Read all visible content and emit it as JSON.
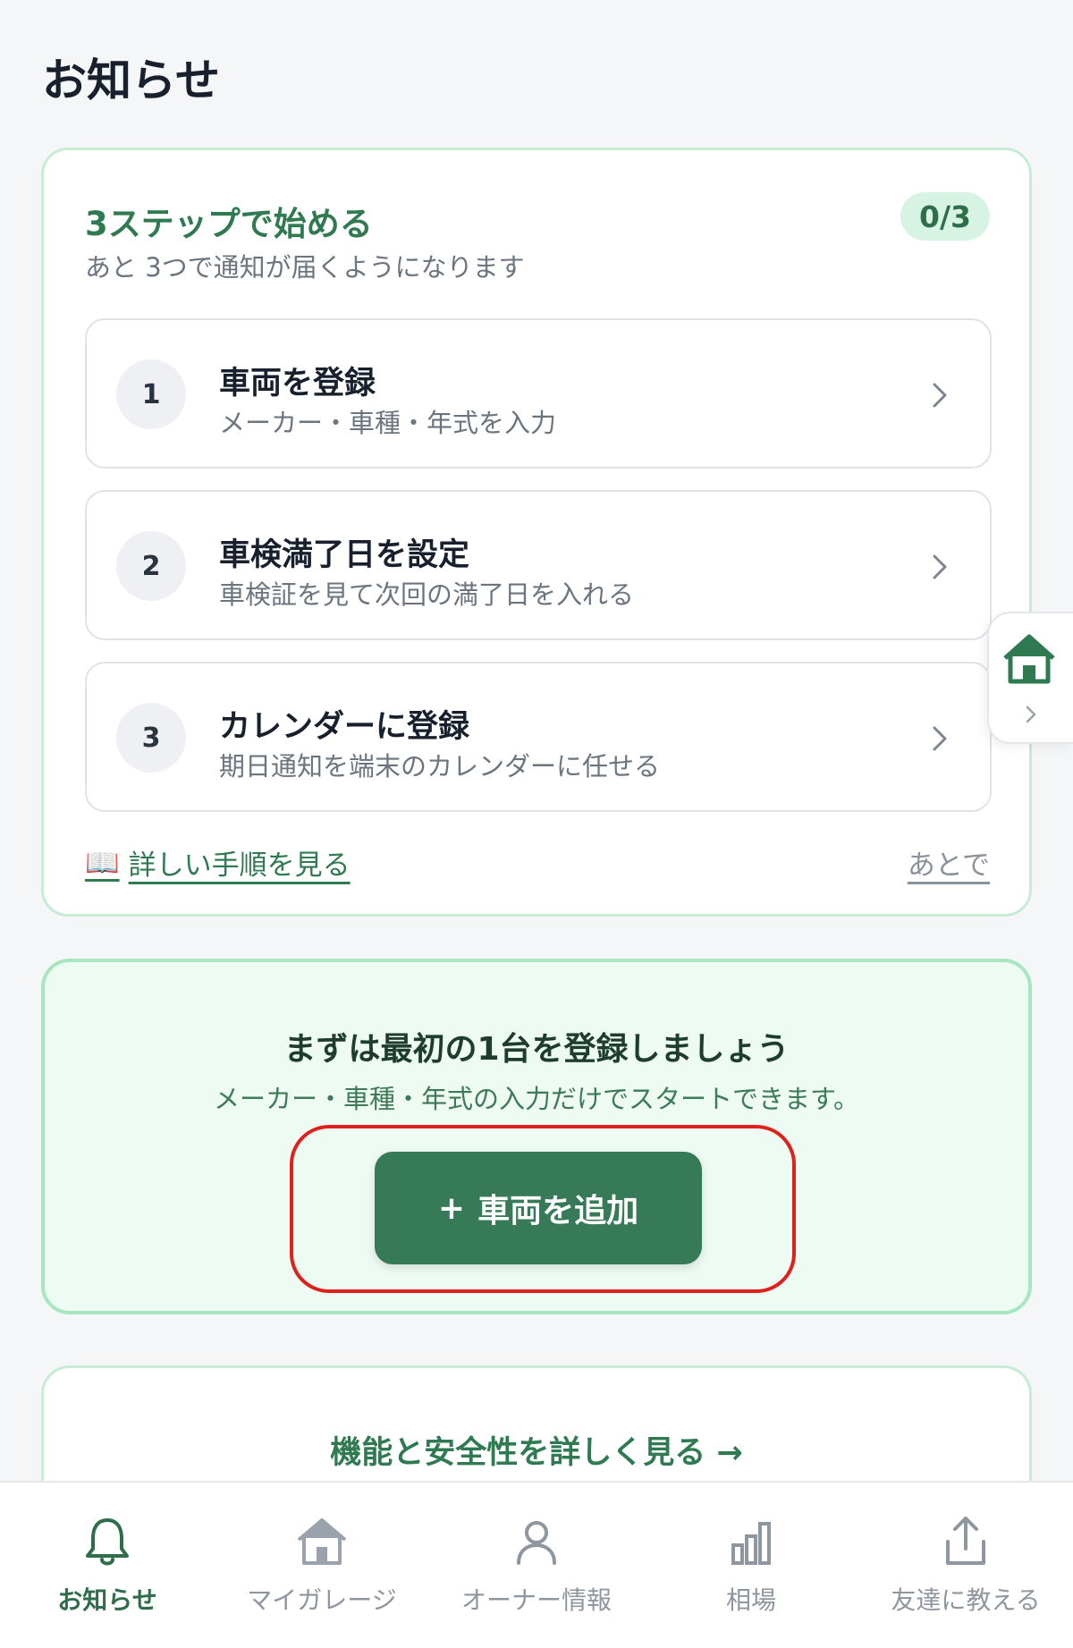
{
  "header": {
    "title": "お知らせ"
  },
  "onboarding": {
    "title": "3ステップで始める",
    "progress": "0/3",
    "subtitle": "あと 3つで通知が届くようになります",
    "steps": [
      {
        "number": "1",
        "title": "車両を登録",
        "description": "メーカー・車種・年式を入力"
      },
      {
        "number": "2",
        "title": "車検満了日を設定",
        "description": "車検証を見て次回の満了日を入れる"
      },
      {
        "number": "3",
        "title": "カレンダーに登録",
        "description": "期日通知を端末のカレンダーに任せる"
      }
    ],
    "guide_icon": "📖",
    "guide_link": "詳しい手順を見る",
    "later_link": "あとで"
  },
  "cta": {
    "title": "まずは最初の1台を登録しましょう",
    "subtitle": "メーカー・車種・年式の入力だけでスタートできます。",
    "button_icon": "+",
    "button_label": "車両を追加"
  },
  "features": {
    "link": "機能と安全性を詳しく見る →"
  },
  "bottom_nav": {
    "items": [
      {
        "label": "お知らせ",
        "icon": "bell-icon",
        "active": true
      },
      {
        "label": "マイガレージ",
        "icon": "house-icon",
        "active": false
      },
      {
        "label": "オーナー情報",
        "icon": "person-icon",
        "active": false
      },
      {
        "label": "相場",
        "icon": "bar-chart-icon",
        "active": false
      },
      {
        "label": "友達に教える",
        "icon": "share-icon",
        "active": false
      }
    ]
  },
  "colors": {
    "accent": "#367a57",
    "accent_text": "#2f7a51",
    "highlight": "#e0201c",
    "background": "#f5f6f8"
  }
}
